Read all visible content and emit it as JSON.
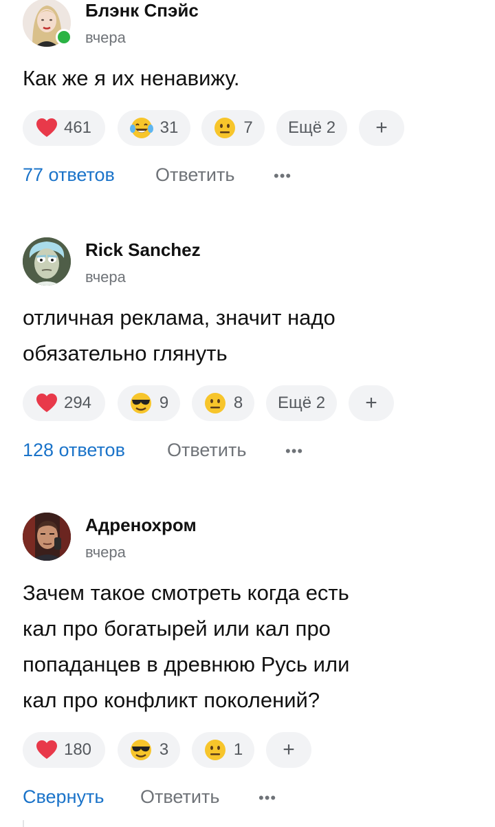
{
  "comments": [
    {
      "author": "Блэнк Спэйс",
      "time": "вчера",
      "online": true,
      "text_lines": [
        "Как же я их ненавижу."
      ],
      "reactions": [
        {
          "icon": "heart-icon",
          "count": "461"
        },
        {
          "icon": "tears-of-joy-icon",
          "count": "31"
        },
        {
          "icon": "neutral-face-icon",
          "count": "7"
        }
      ],
      "more_reactions": "Ещё 2",
      "add_reaction": "+",
      "replies_label": "77 ответов",
      "reply_label": "Ответить",
      "more_label": "•••"
    },
    {
      "author": "Rick Sanchez",
      "time": "вчера",
      "online": false,
      "text_lines": [
        "отличная реклама, значит надо",
        "обязательно глянуть"
      ],
      "reactions": [
        {
          "icon": "heart-icon",
          "count": "294"
        },
        {
          "icon": "sunglasses-face-icon",
          "count": "9"
        },
        {
          "icon": "neutral-face-icon",
          "count": "8"
        }
      ],
      "more_reactions": "Ещё 2",
      "add_reaction": "+",
      "replies_label": "128 ответов",
      "reply_label": "Ответить",
      "more_label": "•••"
    },
    {
      "author": "Адренохром",
      "time": "вчера",
      "online": false,
      "text_lines": [
        "Зачем такое смотреть когда есть",
        "кал про богатырей или кал про",
        "попаданцев в древнюю Русь или",
        "кал про конфликт поколений?"
      ],
      "reactions": [
        {
          "icon": "heart-icon",
          "count": "180"
        },
        {
          "icon": "sunglasses-face-icon",
          "count": "3"
        },
        {
          "icon": "neutral-face-icon",
          "count": "1"
        }
      ],
      "add_reaction": "+",
      "replies_label": "Свернуть",
      "reply_label": "Ответить",
      "more_label": "•••"
    }
  ],
  "colors": {
    "link": "#1a73c9",
    "muted": "#6f7378",
    "pill_bg": "#f2f3f5",
    "online": "#2ab344",
    "heart": "#e8394a",
    "emoji": "#f7c52b"
  }
}
